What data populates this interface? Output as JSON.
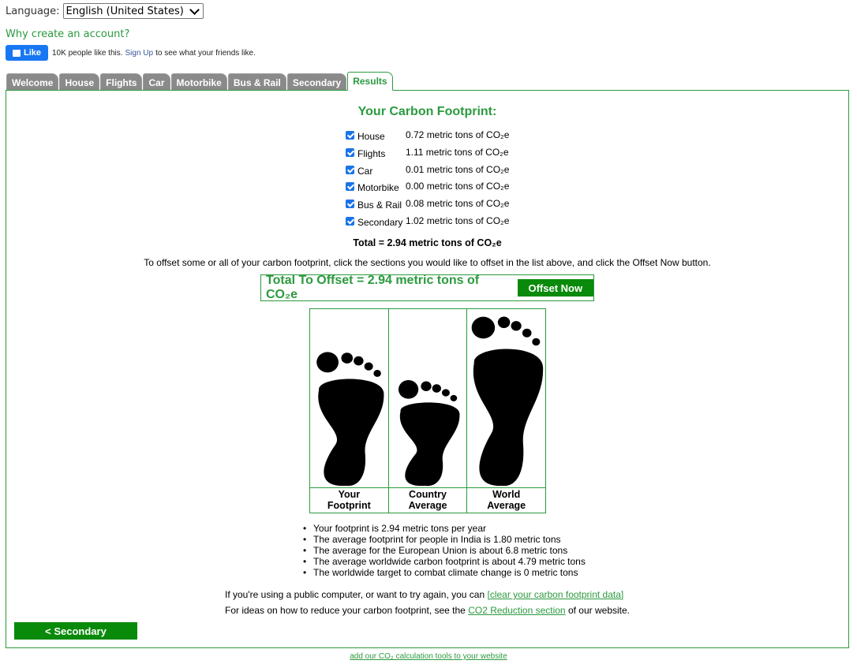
{
  "language": {
    "label": "Language:",
    "selected": "English (United States)"
  },
  "why_account": "Why create an account?",
  "facebook": {
    "like_label": "Like",
    "text_before": "10K people like this.",
    "signup": "Sign Up",
    "text_after": "to see what your friends like."
  },
  "tabs": [
    {
      "label": "Welcome",
      "active": false
    },
    {
      "label": "House",
      "active": false
    },
    {
      "label": "Flights",
      "active": false
    },
    {
      "label": "Car",
      "active": false
    },
    {
      "label": "Motorbike",
      "active": false
    },
    {
      "label": "Bus & Rail",
      "active": false
    },
    {
      "label": "Secondary",
      "active": false
    },
    {
      "label": "Results",
      "active": true
    }
  ],
  "results": {
    "title": "Your Carbon Footprint:",
    "rows": [
      {
        "label": "House",
        "value": "0.72 metric tons of CO₂e",
        "checked": true
      },
      {
        "label": "Flights",
        "value": "1.11 metric tons of CO₂e",
        "checked": true
      },
      {
        "label": "Car",
        "value": "0.01 metric tons of CO₂e",
        "checked": true
      },
      {
        "label": "Motorbike",
        "value": "0.00 metric tons of CO₂e",
        "checked": true
      },
      {
        "label": "Bus & Rail",
        "value": "0.08 metric tons of CO₂e",
        "checked": true
      },
      {
        "label": "Secondary",
        "value": "1.02 metric tons of CO₂e",
        "checked": true
      }
    ],
    "total": "Total = 2.94 metric tons of CO₂e",
    "instruction": "To offset some or all of your carbon footprint, click the sections you would like to offset in the list above, and click the Offset Now button.",
    "offset_total": "Total To Offset = 2.94 metric tons of CO₂e",
    "offset_button": "Offset Now"
  },
  "footprints": [
    {
      "label_line1": "Your",
      "label_line2": "Footprint",
      "value": 2.94
    },
    {
      "label_line1": "Country",
      "label_line2": "Average",
      "value": 1.8
    },
    {
      "label_line1": "World",
      "label_line2": "Average",
      "value": 4.79
    }
  ],
  "bullets": [
    "Your footprint is 2.94 metric tons per year",
    "The average footprint for people in India is 1.80 metric tons",
    "The average for the European Union is about 6.8 metric tons",
    "The average worldwide carbon footprint is about 4.79 metric tons",
    "The worldwide target to combat climate change is 0 metric tons"
  ],
  "note1": {
    "text": "If you're using a public computer, or want to try again, you can",
    "link": "[clear your carbon footprint data]"
  },
  "note2": {
    "text_before": "For ideas on how to reduce your carbon footprint, see the",
    "link": "CO2 Reduction section",
    "text_after": "of our website."
  },
  "back_button": "< Secondary",
  "footer_link": "add our CO₂ calculation tools to your website",
  "colors": {
    "green": "#2b9a3e",
    "button_green": "#0a8a0a",
    "tab_gray": "#8a8a8a",
    "facebook_blue": "#1877f2",
    "checkbox_blue": "#1a73e8"
  }
}
